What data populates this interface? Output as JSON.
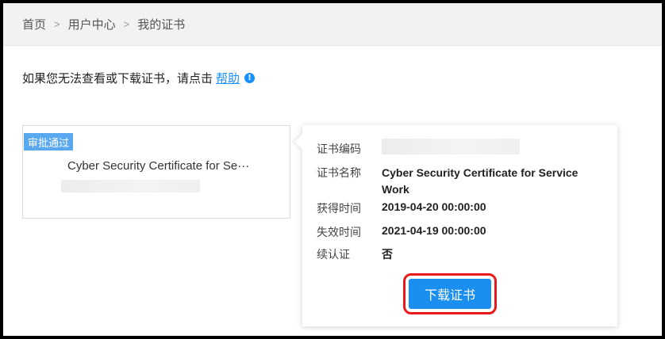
{
  "breadcrumb": {
    "items": [
      "首页",
      "用户中心",
      "我的证书"
    ],
    "separator": ">"
  },
  "help": {
    "text": "如果您无法查看或下载证书，请点击",
    "link": "帮助",
    "icon": "info-icon"
  },
  "certificate_card": {
    "status": "审批通过",
    "title": "Cyber Security Certificate for Se···"
  },
  "detail": {
    "code_label": "证书编码",
    "name_label": "证书名称",
    "name_value": "Cyber Security Certificate for Service Work",
    "obtained_label": "获得时间",
    "obtained_value": "2019-04-20 00:00:00",
    "expire_label": "失效时间",
    "expire_value": "2021-04-19 00:00:00",
    "renewal_label": "续认证",
    "renewal_value": "否",
    "download_label": "下载证书"
  },
  "colors": {
    "accent": "#1a8fef",
    "status_tag": "#5aa9f0",
    "highlight_border": "#e81919"
  }
}
